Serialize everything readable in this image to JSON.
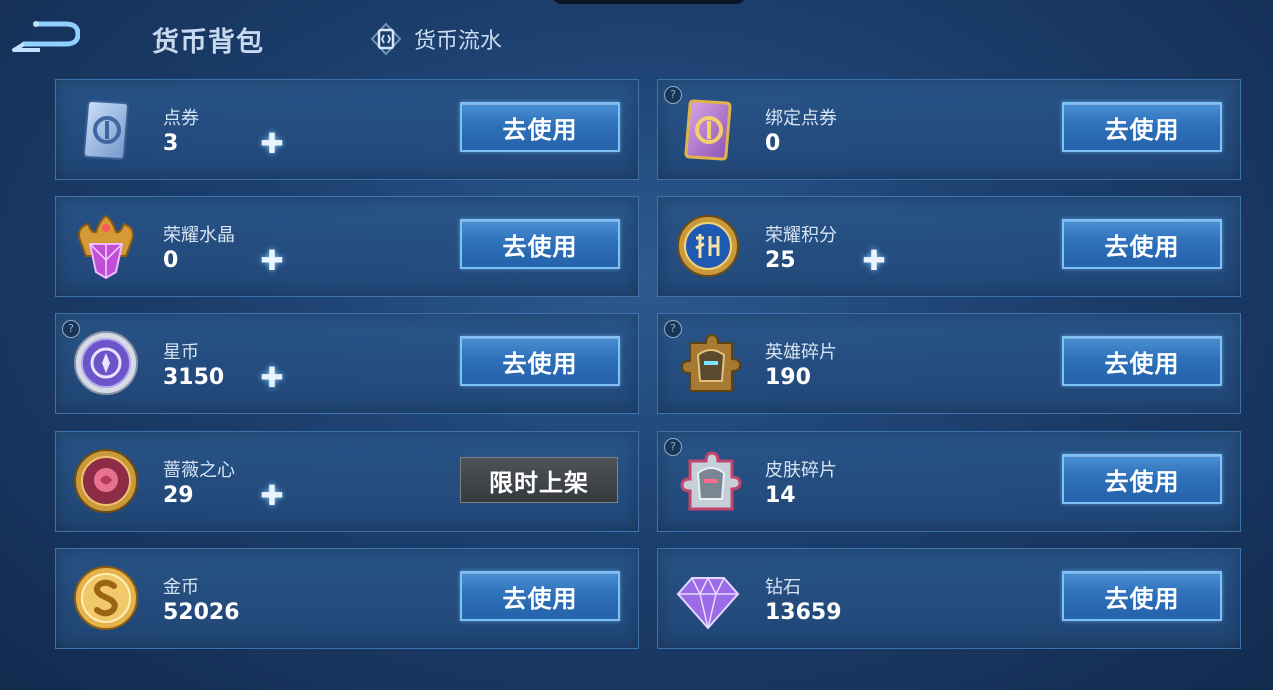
{
  "header": {
    "title": "货币背包",
    "flow_label": "货币流水"
  },
  "cards": {
    "dianquan": {
      "name": "点券",
      "amount": "3",
      "action": "去使用"
    },
    "bound_dianquan": {
      "name": "绑定点券",
      "amount": "0",
      "action": "去使用"
    },
    "glory_crystal": {
      "name": "荣耀水晶",
      "amount": "0",
      "action": "去使用"
    },
    "glory_points": {
      "name": "荣耀积分",
      "amount": "25",
      "action": "去使用"
    },
    "star_coin": {
      "name": "星币",
      "amount": "3150",
      "action": "去使用"
    },
    "hero_fragment": {
      "name": "英雄碎片",
      "amount": "190",
      "action": "去使用"
    },
    "rose_heart": {
      "name": "蔷薇之心",
      "amount": "29",
      "action": "限时上架"
    },
    "skin_fragment": {
      "name": "皮肤碎片",
      "amount": "14",
      "action": "去使用"
    },
    "gold": {
      "name": "金币",
      "amount": "52026",
      "action": "去使用"
    },
    "diamond": {
      "name": "钻石",
      "amount": "13659",
      "action": "去使用"
    }
  },
  "symbols": {
    "plus": "✚",
    "help": "?"
  },
  "colors": {
    "accent": "#2d6fb8",
    "button_border": "#7fc0f5",
    "disabled_button": "#3e4246",
    "background": "#1c3f6e"
  }
}
